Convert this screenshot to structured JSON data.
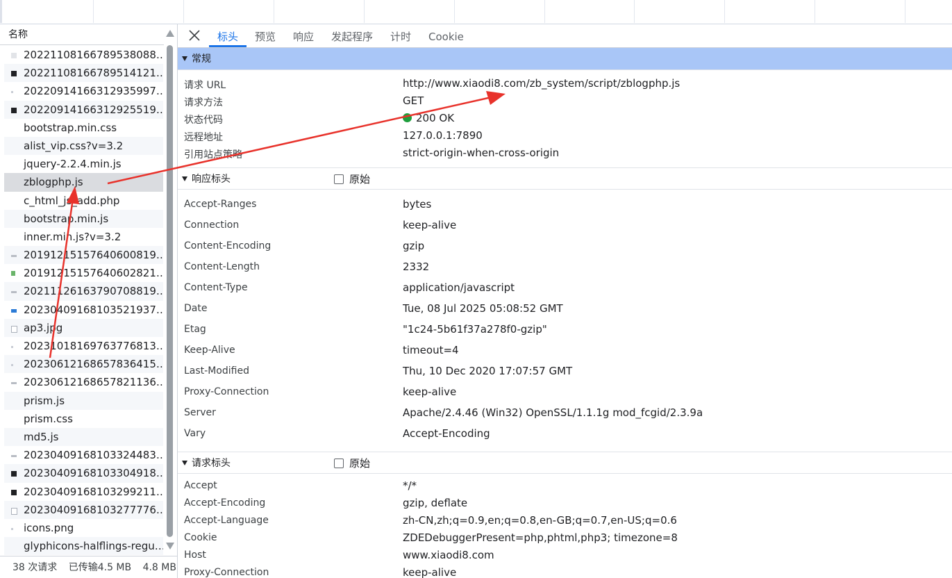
{
  "list": {
    "header": "名称",
    "items": [
      {
        "name": "20221108166789538088…",
        "icon": "faint"
      },
      {
        "name": "20221108166789514121…",
        "icon": "dark"
      },
      {
        "name": "20220914166312935997…",
        "icon": "tiny"
      },
      {
        "name": "20220914166312925519…",
        "icon": "dark"
      },
      {
        "name": "bootstrap.min.css",
        "icon": "none"
      },
      {
        "name": "alist_vip.css?v=3.2",
        "icon": "none"
      },
      {
        "name": "jquery-2.2.4.min.js",
        "icon": "none"
      },
      {
        "name": "zblogphp.js",
        "icon": "none"
      },
      {
        "name": "c_html_js_add.php",
        "icon": "none"
      },
      {
        "name": "bootstrap.min.js",
        "icon": "none"
      },
      {
        "name": "inner.min.js?v=3.2",
        "icon": "none"
      },
      {
        "name": "20191215157640600819…",
        "icon": "gray"
      },
      {
        "name": "20191215157640602821…",
        "icon": "green"
      },
      {
        "name": "20211126163790708819…",
        "icon": "gray"
      },
      {
        "name": "20230409168103521937…",
        "icon": "blue"
      },
      {
        "name": "ap3.jpg",
        "icon": "frame"
      },
      {
        "name": "20231018169763776813…",
        "icon": "tiny"
      },
      {
        "name": "20230612168657836415…",
        "icon": "tiny"
      },
      {
        "name": "20230612168657821136…",
        "icon": "gray"
      },
      {
        "name": "prism.js",
        "icon": "none"
      },
      {
        "name": "prism.css",
        "icon": "none"
      },
      {
        "name": "md5.js",
        "icon": "none"
      },
      {
        "name": "20230409168103324483…",
        "icon": "gray"
      },
      {
        "name": "20230409168103304918…",
        "icon": "dark"
      },
      {
        "name": "20230409168103299211…",
        "icon": "dark"
      },
      {
        "name": "20230409168103277776…",
        "icon": "frame"
      },
      {
        "name": "icons.png",
        "icon": "tiny"
      },
      {
        "name": "glyphicons-halflings-regu…",
        "icon": "none"
      }
    ],
    "selected_index": 7
  },
  "status_bar": {
    "requests": "38 次请求",
    "transferred": "已传输4.5 MB",
    "resources": "4.8 MB"
  },
  "tabs": [
    "标头",
    "预览",
    "响应",
    "发起程序",
    "计时",
    "Cookie"
  ],
  "active_tab": "标头",
  "general": {
    "title": "常规",
    "rows": [
      {
        "key": "请求 URL",
        "value": "http://www.xiaodi8.com/zb_system/script/zblogphp.js"
      },
      {
        "key": "请求方法",
        "value": "GET"
      },
      {
        "key": "状态代码",
        "value": "200 OK"
      },
      {
        "key": "远程地址",
        "value": "127.0.0.1:7890"
      },
      {
        "key": "引用站点策略",
        "value": "strict-origin-when-cross-origin"
      }
    ]
  },
  "response_headers": {
    "title": "响应标头",
    "raw_label": "原始",
    "rows": [
      {
        "key": "Accept-Ranges",
        "value": "bytes"
      },
      {
        "key": "Connection",
        "value": "keep-alive"
      },
      {
        "key": "Content-Encoding",
        "value": "gzip"
      },
      {
        "key": "Content-Length",
        "value": "2332"
      },
      {
        "key": "Content-Type",
        "value": "application/javascript"
      },
      {
        "key": "Date",
        "value": "Tue, 08 Jul 2025 05:08:52 GMT"
      },
      {
        "key": "Etag",
        "value": "\"1c24-5b61f37a278f0-gzip\""
      },
      {
        "key": "Keep-Alive",
        "value": "timeout=4"
      },
      {
        "key": "Last-Modified",
        "value": "Thu, 10 Dec 2020 17:07:57 GMT"
      },
      {
        "key": "Proxy-Connection",
        "value": "keep-alive"
      },
      {
        "key": "Server",
        "value": "Apache/2.4.46 (Win32) OpenSSL/1.1.1g mod_fcgid/2.3.9a"
      },
      {
        "key": "Vary",
        "value": "Accept-Encoding"
      }
    ]
  },
  "request_headers": {
    "title": "请求标头",
    "raw_label": "原始",
    "rows": [
      {
        "key": "Accept",
        "value": "*/*"
      },
      {
        "key": "Accept-Encoding",
        "value": "gzip, deflate"
      },
      {
        "key": "Accept-Language",
        "value": "zh-CN,zh;q=0.9,en;q=0.8,en-GB;q=0.7,en-US;q=0.6"
      },
      {
        "key": "Cookie",
        "value": "ZDEDebuggerPresent=php,phtml,php3; timezone=8"
      },
      {
        "key": "Host",
        "value": "www.xiaodi8.com"
      },
      {
        "key": "Proxy-Connection",
        "value": "keep-alive"
      }
    ]
  },
  "colors": {
    "accent": "#1a73e8",
    "general_header": "#a9c6f7",
    "status_ok": "#1e9e3c",
    "annotation_arrow": "#e8322b"
  }
}
